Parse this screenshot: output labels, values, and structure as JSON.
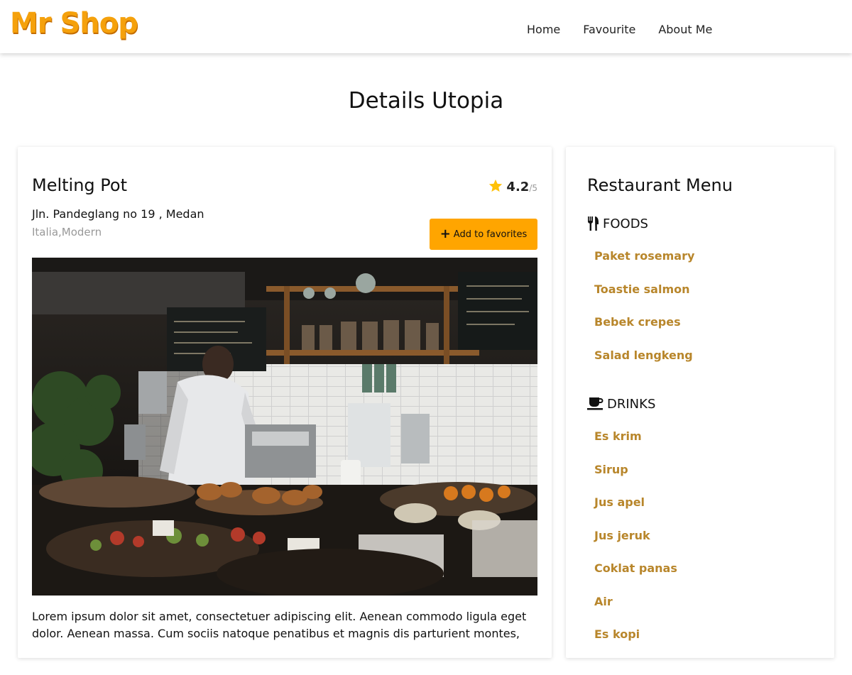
{
  "header": {
    "logo": "Mr Shop",
    "nav": [
      "Home",
      "Favourite",
      "About Me"
    ]
  },
  "page_title": "Details Utopia",
  "restaurant": {
    "name": "Melting Pot",
    "rating": "4.2",
    "rating_max": "/5",
    "address": "Jln. Pandeglang no 19 , Medan",
    "categories": "Italia,Modern",
    "favorite_button": "Add to favorites",
    "photo_icon": "restaurant-photo",
    "description": "Lorem ipsum dolor sit amet, consectetuer adipiscing elit. Aenean commodo ligula eget dolor. Aenean massa. Cum sociis natoque penatibus et magnis dis parturient montes,"
  },
  "menu": {
    "title": "Restaurant Menu",
    "foods_label": "FOODS",
    "foods_icon": "utensils-icon",
    "foods": [
      "Paket rosemary",
      "Toastie salmon",
      "Bebek crepes",
      "Salad lengkeng"
    ],
    "drinks_label": "DRINKS",
    "drinks_icon": "coffee-icon",
    "drinks": [
      "Es krim",
      "Sirup",
      "Jus apel",
      "Jus jeruk",
      "Coklat panas",
      "Air",
      "Es kopi"
    ]
  },
  "colors": {
    "accent": "#ffa500",
    "menu_item": "#b8862b",
    "logo": "#f5a10c"
  }
}
